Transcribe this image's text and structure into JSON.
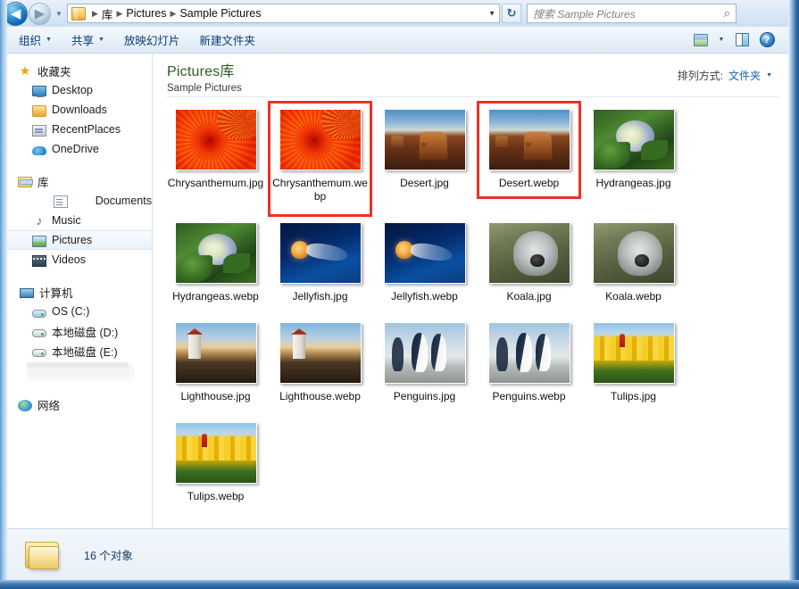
{
  "addressbar": {
    "back_label": "◀",
    "forward_label": "▶",
    "history_caret": "▼",
    "breadcrumb": [
      "库",
      "Pictures",
      "Sample Pictures"
    ],
    "separator": "▶",
    "dropdown_caret": "▼",
    "refresh_label": "↻",
    "search_placeholder": "搜索 Sample Pictures",
    "search_icon": "⌕"
  },
  "toolbar": {
    "items": [
      {
        "label": "组织",
        "has_caret": true
      },
      {
        "label": "共享",
        "has_caret": true
      },
      {
        "label": "放映幻灯片",
        "has_caret": false
      },
      {
        "label": "新建文件夹",
        "has_caret": false
      }
    ],
    "caret": "▼",
    "view_caret": "▼",
    "help_label": "?"
  },
  "sidebar": {
    "groups": [
      {
        "head": {
          "label": "收藏夹",
          "icon": "star-icon"
        },
        "items": [
          {
            "label": "Desktop",
            "icon": "desktop-icon",
            "selected": false
          },
          {
            "label": "Downloads",
            "icon": "folder-icon",
            "selected": false
          },
          {
            "label": "RecentPlaces",
            "icon": "recent-places-icon",
            "selected": false
          },
          {
            "label": "OneDrive",
            "icon": "cloud-icon",
            "selected": false
          }
        ]
      },
      {
        "head": {
          "label": "库",
          "icon": "library-icon"
        },
        "items": [
          {
            "label": "Documents",
            "icon": "document-icon",
            "selected": false
          },
          {
            "label": "Music",
            "icon": "music-icon",
            "selected": false
          },
          {
            "label": "Pictures",
            "icon": "pictures-icon",
            "selected": true
          },
          {
            "label": "Videos",
            "icon": "video-icon",
            "selected": false
          }
        ]
      },
      {
        "head": {
          "label": "计算机",
          "icon": "computer-icon"
        },
        "items": [
          {
            "label": "OS (C:)",
            "icon": "os-drive-icon",
            "selected": false
          },
          {
            "label": "本地磁盘 (D:)",
            "icon": "drive-icon",
            "selected": false
          },
          {
            "label": "本地磁盘 (E:)",
            "icon": "drive-icon",
            "selected": false
          }
        ]
      },
      {
        "head": {
          "label": "网络",
          "icon": "network-icon"
        },
        "items": []
      }
    ]
  },
  "content": {
    "library_title": "Pictures库",
    "library_subtitle": "Sample Pictures",
    "arrange_label": "排列方式:",
    "arrange_value": "文件夹",
    "arrange_caret": "▼",
    "files": [
      {
        "name": "Chrysanthemum.jpg",
        "art": "t-chrys",
        "highlighted": false
      },
      {
        "name": "Chrysanthemum.webp",
        "art": "t-chrys",
        "highlighted": true
      },
      {
        "name": "Desert.jpg",
        "art": "t-desert",
        "highlighted": false
      },
      {
        "name": "Desert.webp",
        "art": "t-desert",
        "highlighted": true
      },
      {
        "name": "Hydrangeas.jpg",
        "art": "t-hydr",
        "highlighted": false
      },
      {
        "name": "Hydrangeas.webp",
        "art": "t-hydr",
        "highlighted": false
      },
      {
        "name": "Jellyfish.jpg",
        "art": "t-jelly",
        "highlighted": false
      },
      {
        "name": "Jellyfish.webp",
        "art": "t-jelly",
        "highlighted": false
      },
      {
        "name": "Koala.jpg",
        "art": "t-koala",
        "highlighted": false
      },
      {
        "name": "Koala.webp",
        "art": "t-koala",
        "highlighted": false
      },
      {
        "name": "Lighthouse.jpg",
        "art": "t-light",
        "highlighted": false
      },
      {
        "name": "Lighthouse.webp",
        "art": "t-light",
        "highlighted": false
      },
      {
        "name": "Penguins.jpg",
        "art": "t-peng",
        "highlighted": false
      },
      {
        "name": "Penguins.webp",
        "art": "t-peng",
        "highlighted": false
      },
      {
        "name": "Tulips.jpg",
        "art": "t-tulip",
        "highlighted": false
      },
      {
        "name": "Tulips.webp",
        "art": "t-tulip",
        "highlighted": false
      }
    ]
  },
  "statusbar": {
    "text": "16 个对象"
  },
  "colors": {
    "highlight": "#ee3124",
    "library_title": "#2b5d1f",
    "link": "#1a60b0"
  }
}
